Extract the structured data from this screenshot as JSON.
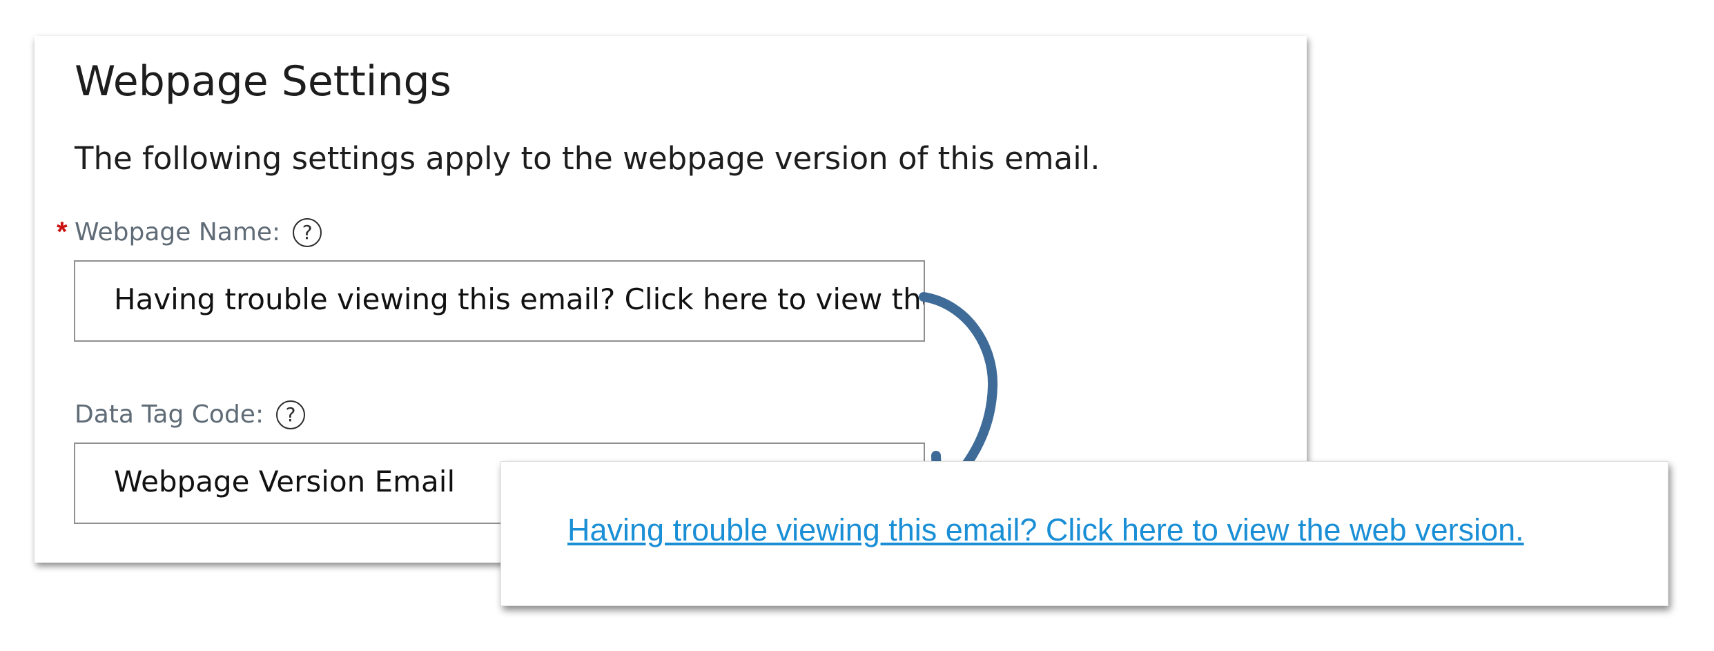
{
  "settings": {
    "title": "Webpage Settings",
    "intro": "The following settings apply to the webpage version of this email.",
    "required_marker": "*",
    "help_glyph": "?",
    "webpage_name": {
      "label": "Webpage Name:",
      "value": "Having trouble viewing this email? Click here to view the web version."
    },
    "data_tag_code": {
      "label": "Data Tag Code:",
      "value": "Webpage Version Email"
    }
  },
  "preview": {
    "link_text": "Having trouble viewing this email? Click here to view the web version."
  },
  "colors": {
    "link": "#1a8fd6",
    "required": "#cc1111",
    "arrow": "#3e6b97"
  },
  "icons": {
    "help": "help-circle-icon",
    "arrow": "curved-arrow-icon"
  }
}
